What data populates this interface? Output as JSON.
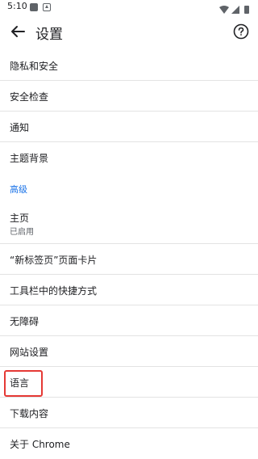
{
  "status_bar": {
    "time": "5:10"
  },
  "app_bar": {
    "title": "设置"
  },
  "settings": {
    "privacy": "隐私和安全",
    "safety_check": "安全检查",
    "notifications": "通知",
    "themes": "主题背景",
    "advanced_header": "高级",
    "homepage": {
      "label": "主页",
      "sublabel": "已启用"
    },
    "new_tab_cards": "“新标签页”页面卡片",
    "toolbar_shortcut": "工具栏中的快捷方式",
    "accessibility": "无障碍",
    "site_settings": "网站设置",
    "languages": "语言",
    "downloads": "下载内容",
    "about": "关于 Chrome"
  },
  "colors": {
    "accent": "#1a73e8",
    "highlight": "#e53935",
    "divider": "#e3e3e3"
  },
  "icons": {
    "back": "arrow-left-icon",
    "help": "help-circle-icon"
  }
}
